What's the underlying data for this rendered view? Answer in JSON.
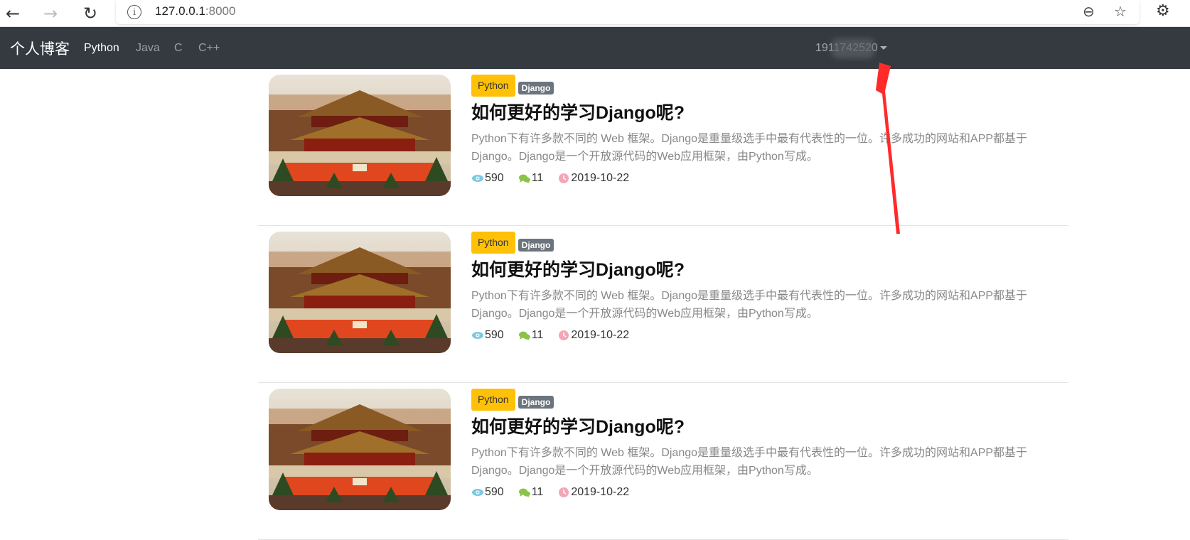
{
  "browser": {
    "back_glyph": "←",
    "forward_glyph": "→",
    "reload_glyph": "↻",
    "info_glyph": "i",
    "url_host": "127.0.0.1",
    "url_port": ":8000",
    "zoom_glyph": "⊖",
    "favorites_glyph": "☆",
    "extensions_glyph": "⚙"
  },
  "navbar": {
    "brand": "个人博客",
    "links": [
      {
        "label": "Python",
        "active": true
      },
      {
        "label": "Java",
        "active": false
      },
      {
        "label": "C",
        "active": false
      },
      {
        "label": "C++",
        "active": false
      }
    ],
    "user": "1911742520"
  },
  "posts": [
    {
      "category": "Python",
      "tag": "Django",
      "title": "如何更好的学习Django呢?",
      "excerpt": "Python下有许多款不同的 Web 框架。Django是重量级选手中最有代表性的一位。许多成功的网站和APP都基于Django。Django是一个开放源代码的Web应用框架，由Python写成。",
      "views": "590",
      "comments": "11",
      "date": "2019-10-22"
    },
    {
      "category": "Python",
      "tag": "Django",
      "title": "如何更好的学习Django呢?",
      "excerpt": "Python下有许多款不同的 Web 框架。Django是重量级选手中最有代表性的一位。许多成功的网站和APP都基于Django。Django是一个开放源代码的Web应用框架，由Python写成。",
      "views": "590",
      "comments": "11",
      "date": "2019-10-22"
    },
    {
      "category": "Python",
      "tag": "Django",
      "title": "如何更好的学习Django呢?",
      "excerpt": "Python下有许多款不同的 Web 框架。Django是重量级选手中最有代表性的一位。许多成功的网站和APP都基于Django。Django是一个开放源代码的Web应用框架，由Python写成。",
      "views": "590",
      "comments": "11",
      "date": "2019-10-22"
    }
  ],
  "colors": {
    "navbar_bg": "#343a40",
    "category_badge": "#ffc107",
    "tag_badge": "#6c757d",
    "views_icon": "#7ec8e3",
    "comments_icon": "#8bc34a",
    "date_icon": "#f4a6b8",
    "annotation_arrow": "#ff2a2a"
  }
}
